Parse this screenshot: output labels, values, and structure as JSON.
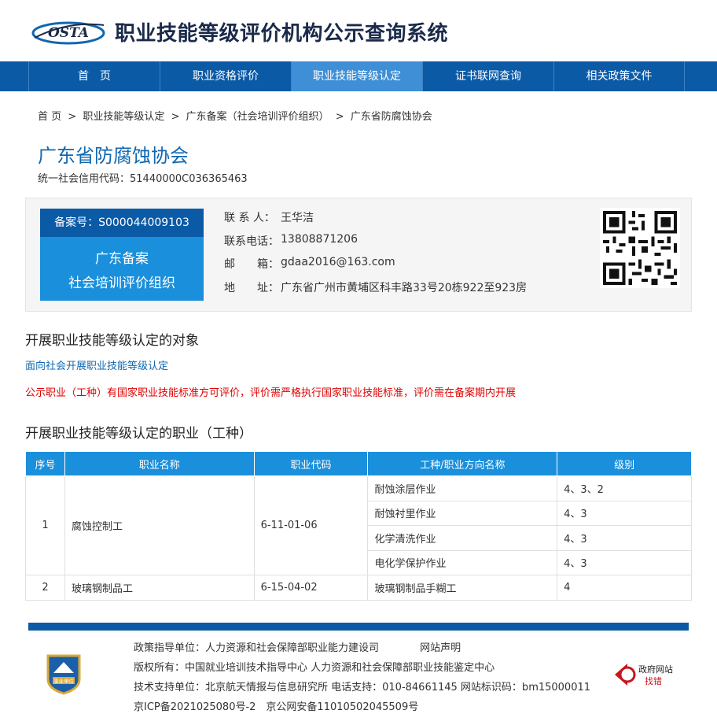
{
  "header": {
    "logo_text": "OSTA",
    "site_title": "职业技能等级评价机构公示查询系统"
  },
  "nav": {
    "items": [
      {
        "label": "首　页"
      },
      {
        "label": "职业资格评价"
      },
      {
        "label": "职业技能等级认定"
      },
      {
        "label": "证书联网查询"
      },
      {
        "label": "相关政策文件"
      }
    ],
    "active_index": 2
  },
  "breadcrumb": {
    "items": [
      "首 页",
      "职业技能等级认定",
      "广东备案（社会培训评价组织）",
      "广东省防腐蚀协会"
    ],
    "separator": ">"
  },
  "org": {
    "name": "广东省防腐蚀协会",
    "credit_code": "统一社会信用代码：51440000C036365463"
  },
  "registration": {
    "number": "备案号：S000044009103",
    "type_line1": "广东备案",
    "type_line2": "社会培训评价组织"
  },
  "contact": [
    {
      "label": "联 系 人：",
      "value": "王华洁"
    },
    {
      "label": "联系电话：",
      "value": "13808871206"
    },
    {
      "label": "邮　　箱：",
      "value": "gdaa2016@163.com"
    },
    {
      "label": "地　　址：",
      "value": "广东省广州市黄埔区科丰路33号20栋922至923房"
    }
  ],
  "section_target": {
    "title": "开展职业技能等级认定的对象",
    "subtitle": "面向社会开展职业技能等级认定"
  },
  "notice": "公示职业（工种）有国家职业技能标准方可评价，评价需严格执行国家职业技能标准，评价需在备案期内开展",
  "section_jobs": {
    "title": "开展职业技能等级认定的职业（工种）"
  },
  "table": {
    "headers": [
      "序号",
      "职业名称",
      "职业代码",
      "工种/职业方向名称",
      "级别"
    ],
    "rows": [
      {
        "no": "1",
        "name": "腐蚀控制工",
        "code": "6-11-01-06",
        "subs": [
          {
            "name": "耐蚀涂层作业",
            "level": "4、3、2"
          },
          {
            "name": "耐蚀衬里作业",
            "level": "4、3"
          },
          {
            "name": "化学清洗作业",
            "level": "4、3"
          },
          {
            "name": "电化学保护作业",
            "level": "4、3"
          }
        ]
      },
      {
        "no": "2",
        "name": "玻璃钢制品工",
        "code": "6-15-04-02",
        "subs": [
          {
            "name": "玻璃钢制品手糊工",
            "level": "4"
          }
        ]
      }
    ]
  },
  "footer": {
    "line1_left": "政策指导单位：人力资源和社会保障部职业能力建设司",
    "line1_right": "网站声明",
    "line2": "版权所有：中国就业培训技术指导中心 人力资源和社会保障部职业技能鉴定中心",
    "line3": "技术支持单位：北京航天情报与信息研究所 电话支持：010-84661145 网站标识码：bm15000011",
    "line4": "京ICP备2021025080号-2　京公网安备11010502045509号",
    "badge_text": "事业单位",
    "gov_badge_line1": "政府网站",
    "gov_badge_line2": "找错"
  },
  "colors": {
    "nav_bg": "#0b5aa6",
    "nav_active": "#3f8fd6",
    "accent_blue": "#1a8fdb",
    "title_blue": "#1167b1",
    "notice_red": "#e00000"
  }
}
